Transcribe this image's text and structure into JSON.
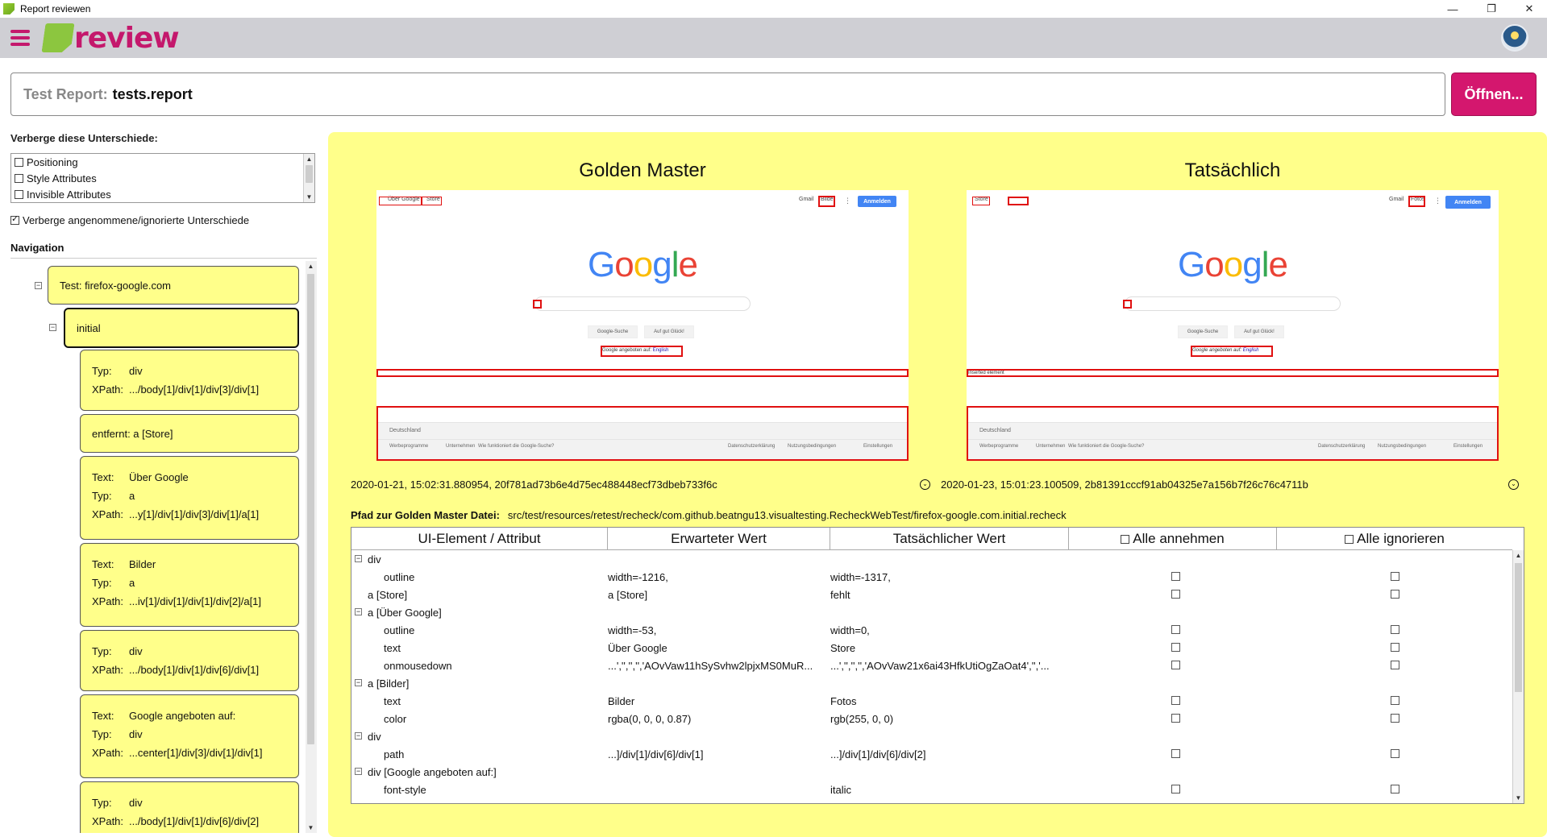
{
  "window": {
    "title": "Report reviewen",
    "minimize": "—",
    "maximize": "❐",
    "close": "✕"
  },
  "header": {
    "logo_text": "review"
  },
  "report": {
    "label": "Test Report:",
    "value": "tests.report",
    "open_button": "Öffnen..."
  },
  "filters": {
    "title": "Verberge diese Unterschiede:",
    "items": [
      {
        "label": "Positioning",
        "checked": false
      },
      {
        "label": "Style Attributes",
        "checked": false
      },
      {
        "label": "Invisible Attributes",
        "checked": false
      }
    ],
    "hide_accepted": "Verberge angenommene/ignorierte Unterschiede"
  },
  "navigation": {
    "title": "Navigation",
    "test": "Test: firefox-google.com",
    "state": "initial",
    "entries": [
      {
        "rows": [
          [
            "Typ:",
            "div"
          ],
          [
            "XPath:",
            ".../body[1]/div[1]/div[3]/div[1]"
          ]
        ]
      },
      {
        "single": "entfernt: a [Store]"
      },
      {
        "rows": [
          [
            "Text:",
            "Über Google"
          ],
          [
            "Typ:",
            "a"
          ],
          [
            "XPath:",
            "...y[1]/div[1]/div[3]/div[1]/a[1]"
          ]
        ]
      },
      {
        "rows": [
          [
            "Text:",
            "Bilder"
          ],
          [
            "Typ:",
            "a"
          ],
          [
            "XPath:",
            "...iv[1]/div[1]/div[1]/div[2]/a[1]"
          ]
        ]
      },
      {
        "rows": [
          [
            "Typ:",
            "div"
          ],
          [
            "XPath:",
            ".../body[1]/div[1]/div[6]/div[1]"
          ]
        ]
      },
      {
        "rows": [
          [
            "Text:",
            "Google angeboten auf:"
          ],
          [
            "Typ:",
            "div"
          ],
          [
            "XPath:",
            "...center[1]/div[3]/div[1]/div[1]"
          ]
        ]
      },
      {
        "rows": [
          [
            "Typ:",
            "div"
          ],
          [
            "XPath:",
            ".../body[1]/div[1]/div[6]/div[2]"
          ]
        ]
      }
    ]
  },
  "compare": {
    "left_title": "Golden Master",
    "right_title": "Tatsächlich",
    "left_meta": "2020-01-21, 15:02:31.880954, 20f781ad73b6e4d75ec488448ecf73dbeb733f6c",
    "right_meta": "2020-01-23, 15:01:23.100509, 2b81391cccf91ab04325e7a156b7f26c76c4711b",
    "path_label": "Pfad zur Golden Master Datei:",
    "path_value": "src/test/resources/retest/recheck/com.github.beatngu13.visualtesting.RecheckWebTest/firefox-google.com.initial.recheck",
    "left_shot": {
      "about": "Über Google",
      "store": "Store",
      "gmail": "Gmail",
      "images": "Bilder",
      "signin": "Anmelden",
      "logo": [
        "G",
        "o",
        "o",
        "g",
        "l",
        "e"
      ],
      "btn_search": "Google-Suche",
      "btn_lucky": "Auf gut Glück!",
      "offered": "Google angeboten auf:",
      "offered_lang": "English",
      "country": "Deutschland",
      "footer_left": [
        "Werbeprogramme",
        "Unternehmen",
        "Wie funktioniert die Google-Suche?"
      ],
      "footer_right": [
        "Datenschutzerklärung",
        "Nutzungsbedingungen",
        "Einstellungen"
      ]
    },
    "right_shot": {
      "store": "Store",
      "gmail": "Gmail",
      "images": "Fotos",
      "signin": "Anmelden",
      "btn_search": "Google-Suche",
      "btn_lucky": "Auf gut Glück!",
      "offered": "Google angeboten auf:",
      "offered_lang": "English",
      "inserted": "Inserted element",
      "country": "Deutschland",
      "footer_left": [
        "Werbeprogramme",
        "Unternehmen",
        "Wie funktioniert die Google-Suche?"
      ],
      "footer_right": [
        "Datenschutzerklärung",
        "Nutzungsbedingungen",
        "Einstellungen"
      ]
    }
  },
  "table": {
    "headers": {
      "element": "UI-Element / Attribut",
      "expected": "Erwarteter Wert",
      "actual": "Tatsächlicher Wert",
      "accept_all": "Alle annehmen",
      "ignore_all": "Alle ignorieren"
    },
    "rows": [
      {
        "group": true,
        "name": "div"
      },
      {
        "group": false,
        "name": "outline",
        "expected": "width=-1216,",
        "actual": "width=-1317,"
      },
      {
        "group": false,
        "top": true,
        "name": "a [Store]",
        "expected": "a [Store]",
        "actual": "fehlt"
      },
      {
        "group": true,
        "name": "a [Über Google]"
      },
      {
        "group": false,
        "name": "outline",
        "expected": "width=-53,",
        "actual": "width=0,"
      },
      {
        "group": false,
        "name": "text",
        "expected": "Über Google",
        "actual": "Store"
      },
      {
        "group": false,
        "name": "onmousedown",
        "expected": "...','','','','AOvVaw11hSySvhw2lpjxMS0MuR...",
        "actual": "...','','','','AOvVaw21x6ai43HfkUtiOgZaOat4','','..."
      },
      {
        "group": true,
        "name": "a [Bilder]"
      },
      {
        "group": false,
        "name": "text",
        "expected": "Bilder",
        "actual": "Fotos"
      },
      {
        "group": false,
        "name": "color",
        "expected": "rgba(0, 0, 0, 0.87)",
        "actual": "rgb(255, 0, 0)"
      },
      {
        "group": true,
        "name": "div"
      },
      {
        "group": false,
        "name": "path",
        "expected": "...]/div[1]/div[6]/div[1]",
        "actual": "...]/div[1]/div[6]/div[2]"
      },
      {
        "group": true,
        "name": "div [Google angeboten auf:]"
      },
      {
        "group": false,
        "name": "font-style",
        "expected": "",
        "actual": "italic"
      }
    ]
  },
  "colors": {
    "accent": "#d4176e",
    "panel": "#ffff8a",
    "diff": "#e01010"
  }
}
